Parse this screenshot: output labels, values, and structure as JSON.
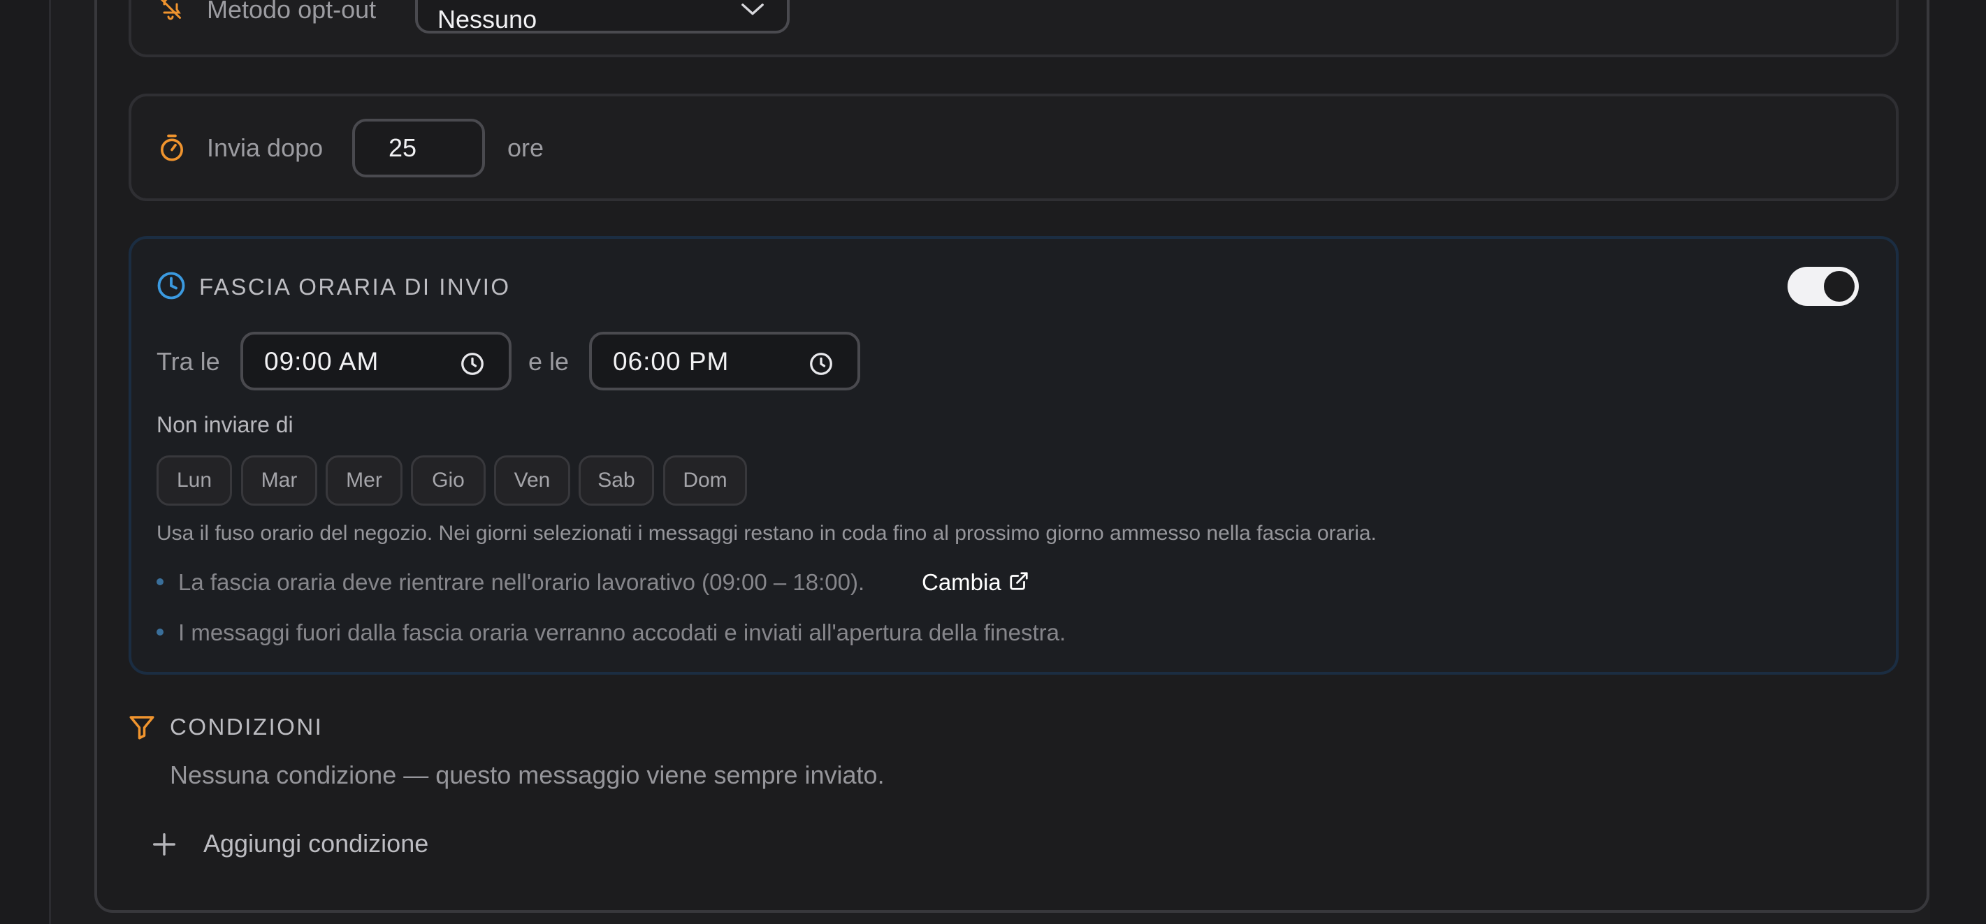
{
  "optout": {
    "label": "Metodo opt-out",
    "selected": "Nessuno",
    "icon": "bell-off-icon"
  },
  "delay": {
    "label": "Invia dopo",
    "value": "25",
    "unit": "ore",
    "icon": "stopwatch-icon"
  },
  "send_window": {
    "title": "FASCIA ORARIA DI INVIO",
    "enabled": true,
    "from_label": "Tra le",
    "from_time": "09:00  AM",
    "to_label": "e le",
    "to_time": "06:00  PM",
    "exclude_label": "Non inviare di",
    "days": [
      "Lun",
      "Mar",
      "Mer",
      "Gio",
      "Ven",
      "Sab",
      "Dom"
    ],
    "note": "Usa il fuso orario del negozio. Nei giorni selezionati i messaggi restano in coda fino al prossimo giorno ammesso nella fascia oraria.",
    "bullet_1": "La fascia oraria deve rientrare nell'orario lavorativo (09:00 – 18:00).",
    "bullet_1_link": "Cambia",
    "bullet_2": "I messaggi fuori dalla fascia oraria verranno accodati e inviati all'apertura della finestra."
  },
  "conditions": {
    "title": "CONDIZIONI",
    "empty_text": "Nessuna condizione — questo messaggio viene sempre inviato.",
    "add_label": "Aggiungi condizione"
  },
  "colors": {
    "accent_orange": "#f0942e",
    "accent_blue": "#3b9ae0",
    "background": "#1e1e20"
  }
}
